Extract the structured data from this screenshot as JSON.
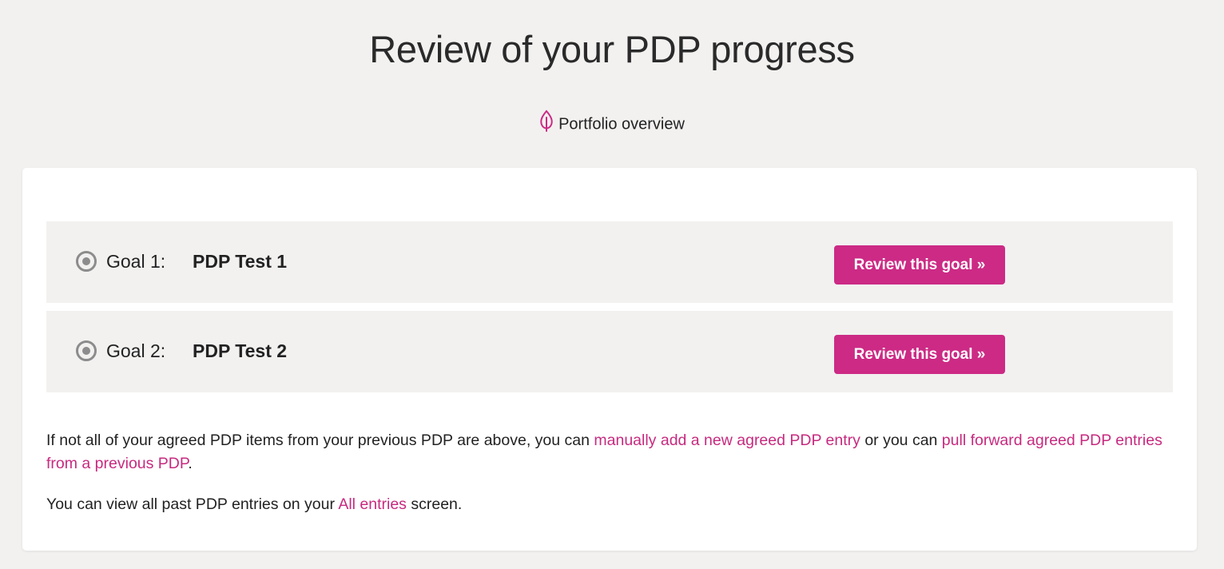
{
  "header": {
    "title": "Review of your PDP progress",
    "overview_link": "Portfolio overview"
  },
  "colors": {
    "accent": "#cc2a85",
    "background": "#f2f1f0",
    "card": "#ffffff"
  },
  "goals": [
    {
      "label": "Goal 1:",
      "name": "PDP Test 1",
      "button": "Review this goal »"
    },
    {
      "label": "Goal 2:",
      "name": "PDP Test 2",
      "button": "Review this goal »"
    }
  ],
  "info": {
    "p1_text_a": "If not all of your agreed PDP items from your previous PDP are above, you can ",
    "p1_link_a": "manually add a new agreed PDP entry",
    "p1_text_b": " or you can ",
    "p1_link_b": "pull forward agreed PDP entries from a previous PDP",
    "p1_text_c": ".",
    "p2_text_a": "You can view all past PDP entries on your ",
    "p2_link": "All entries",
    "p2_text_b": " screen."
  },
  "icons": {
    "overview": "leaf-icon",
    "goal_status": "radio-icon"
  }
}
